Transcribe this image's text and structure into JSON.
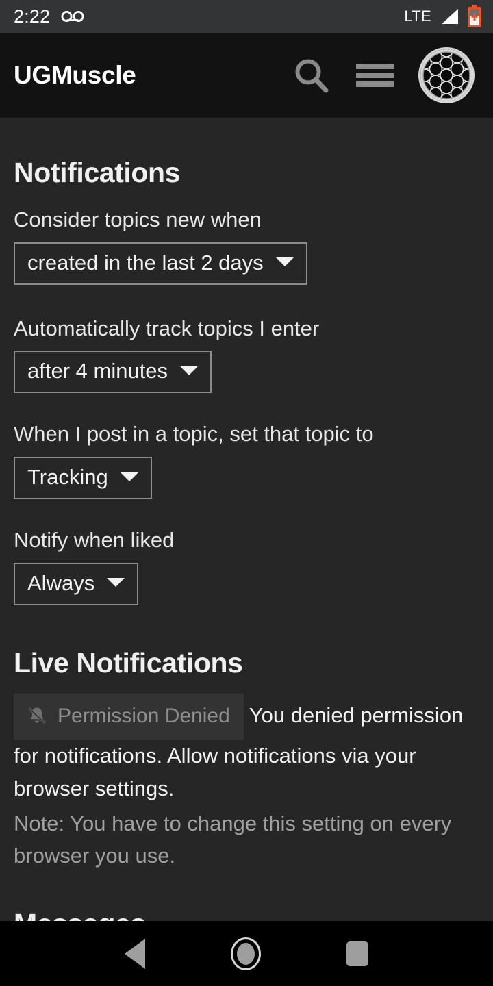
{
  "status_bar": {
    "time": "2:22",
    "voicemail_icon": "voicemail-icon",
    "network_type": "LTE",
    "signal_icon": "signal-bars-icon",
    "battery_icon": "battery-low-icon",
    "battery_color": "#F4511E",
    "background": "#333436"
  },
  "app_bar": {
    "title": "UGMuscle",
    "search_icon": "search-icon",
    "menu_icon": "hamburger-menu-icon",
    "avatar_icon": "flower-of-life-avatar",
    "icon_color": "#8a8a8a",
    "background": "#121212"
  },
  "page": {
    "background": "#262626",
    "text_color": "#f0f0f0",
    "muted_text_color": "#a0a0a0"
  },
  "notifications_section": {
    "heading": "Notifications",
    "settings": [
      {
        "label": "Consider topics new when",
        "value": "created in the last 2 days"
      },
      {
        "label": "Automatically track topics I enter",
        "value": "after 4 minutes"
      },
      {
        "label": "When I post in a topic, set that topic to",
        "value": "Tracking"
      },
      {
        "label": "Notify when liked",
        "value": "Always"
      }
    ]
  },
  "live_notifications_section": {
    "heading": "Live Notifications",
    "permission_button": {
      "label": "Permission Denied",
      "icon": "bell-slash-icon",
      "disabled": true,
      "background": "#333333",
      "text_color": "#8e8e8e"
    },
    "description": "You denied permission for notifications. Allow notifications via your browser settings.",
    "note": "Note: You have to change this setting on every browser you use."
  },
  "messages_section": {
    "heading": "Messages"
  },
  "nav_bar": {
    "background": "#000000",
    "back_icon": "back-triangle-icon",
    "home_icon": "home-circle-icon",
    "recents_icon": "recents-square-icon"
  }
}
